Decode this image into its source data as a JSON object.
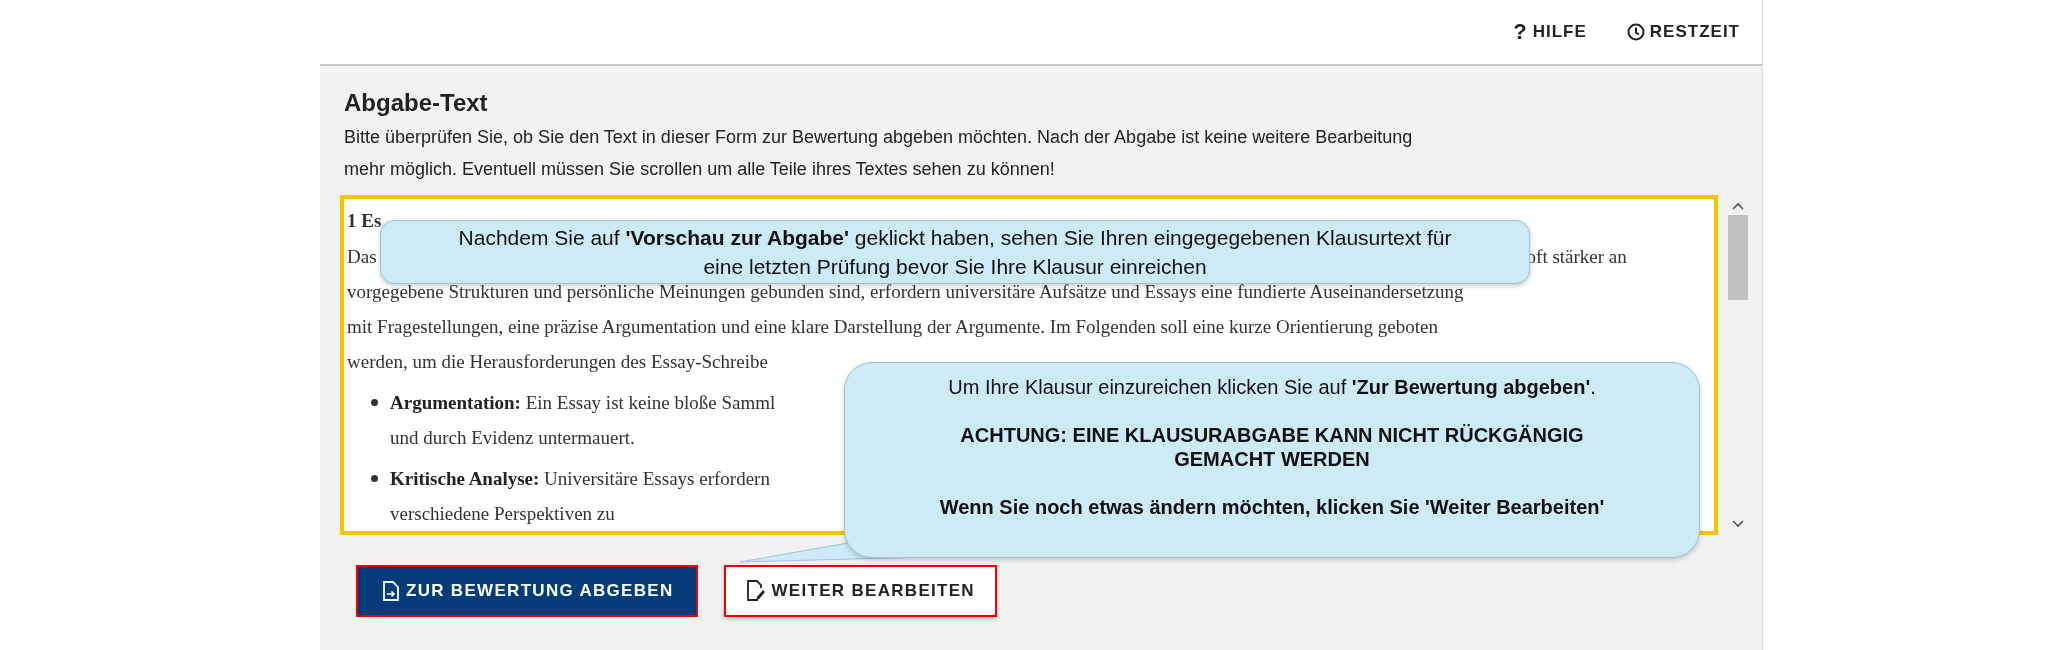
{
  "header": {
    "actions": [
      {
        "kind": "help",
        "glyph": "?",
        "label": "HILFE"
      },
      {
        "kind": "timer",
        "label": "RESTZEIT"
      }
    ]
  },
  "panel": {
    "title": "Abgabe-Text",
    "description": "Bitte überprüfen Sie, ob Sie den Text in dieser Form zur Bewertung abgeben möchten. Nach der Abgabe ist keine weitere Bearbeitung mehr möglich. Eventuell müssen Sie scrollen um alle Teile ihres Textes sehen zu können!",
    "essay": [
      {
        "kind": "heading",
        "text": "1 Es"
      },
      {
        "kind": "split",
        "parts": [
          "Das",
          "oft stärker an"
        ]
      },
      {
        "kind": "text",
        "text": "vorgegebene Strukturen und persönliche Meinungen gebunden sind, erfordern universitäre Aufsätze und Essays eine fundierte Auseinandersetzung"
      },
      {
        "kind": "text",
        "text": "mit Fragestellungen, eine präzise Argumentation und eine klare Darstellung der Argumente. Im Folgenden soll eine kurze Orientierung geboten"
      },
      {
        "kind": "text",
        "text": "werden, um die Herausforderungen des Essay-Schreibe"
      },
      {
        "kind": "bullet",
        "text": "**Argumentation:** Ein Essay ist keine bloße Samml"
      },
      {
        "kind": "continuation",
        "text": "und durch Evidenz untermauert."
      },
      {
        "kind": "bullet",
        "text": "**Kritische Analyse:** Universitäre Essays erfordern"
      },
      {
        "kind": "continuation",
        "text": "verschiedene Perspektiven zu"
      }
    ],
    "buttons": [
      {
        "kind": "primary",
        "label": "ZUR BEWERTUNG ABGEBEN"
      },
      {
        "kind": "secondary",
        "label": "WEITER BEARBEITEN"
      }
    ]
  },
  "callouts": [
    {
      "kind": "top",
      "paragraphs": [
        {
          "kind": "normal",
          "text": "Nachdem Sie auf **'Vorschau zur Abgabe'** geklickt haben, sehen Sie Ihren eingegegebenen Klausurtext für eine letzten Prüfung bevor Sie Ihre Klausur einreichen"
        }
      ]
    },
    {
      "kind": "pointer",
      "paragraphs": [
        {
          "kind": "normal",
          "text": "Um Ihre Klausur einzureichen klicken Sie auf **'Zur Bewertung abgeben'**."
        },
        {
          "kind": "bold",
          "text": "ACHTUNG: EINE KLAUSURABGABE KANN NICHT RÜCKGÄNGIG GEMACHT WERDEN"
        },
        {
          "kind": "bold",
          "text": "Wenn Sie noch etwas ändern möchten, klicken Sie 'Weiter Bearbeiten'"
        }
      ]
    }
  ]
}
